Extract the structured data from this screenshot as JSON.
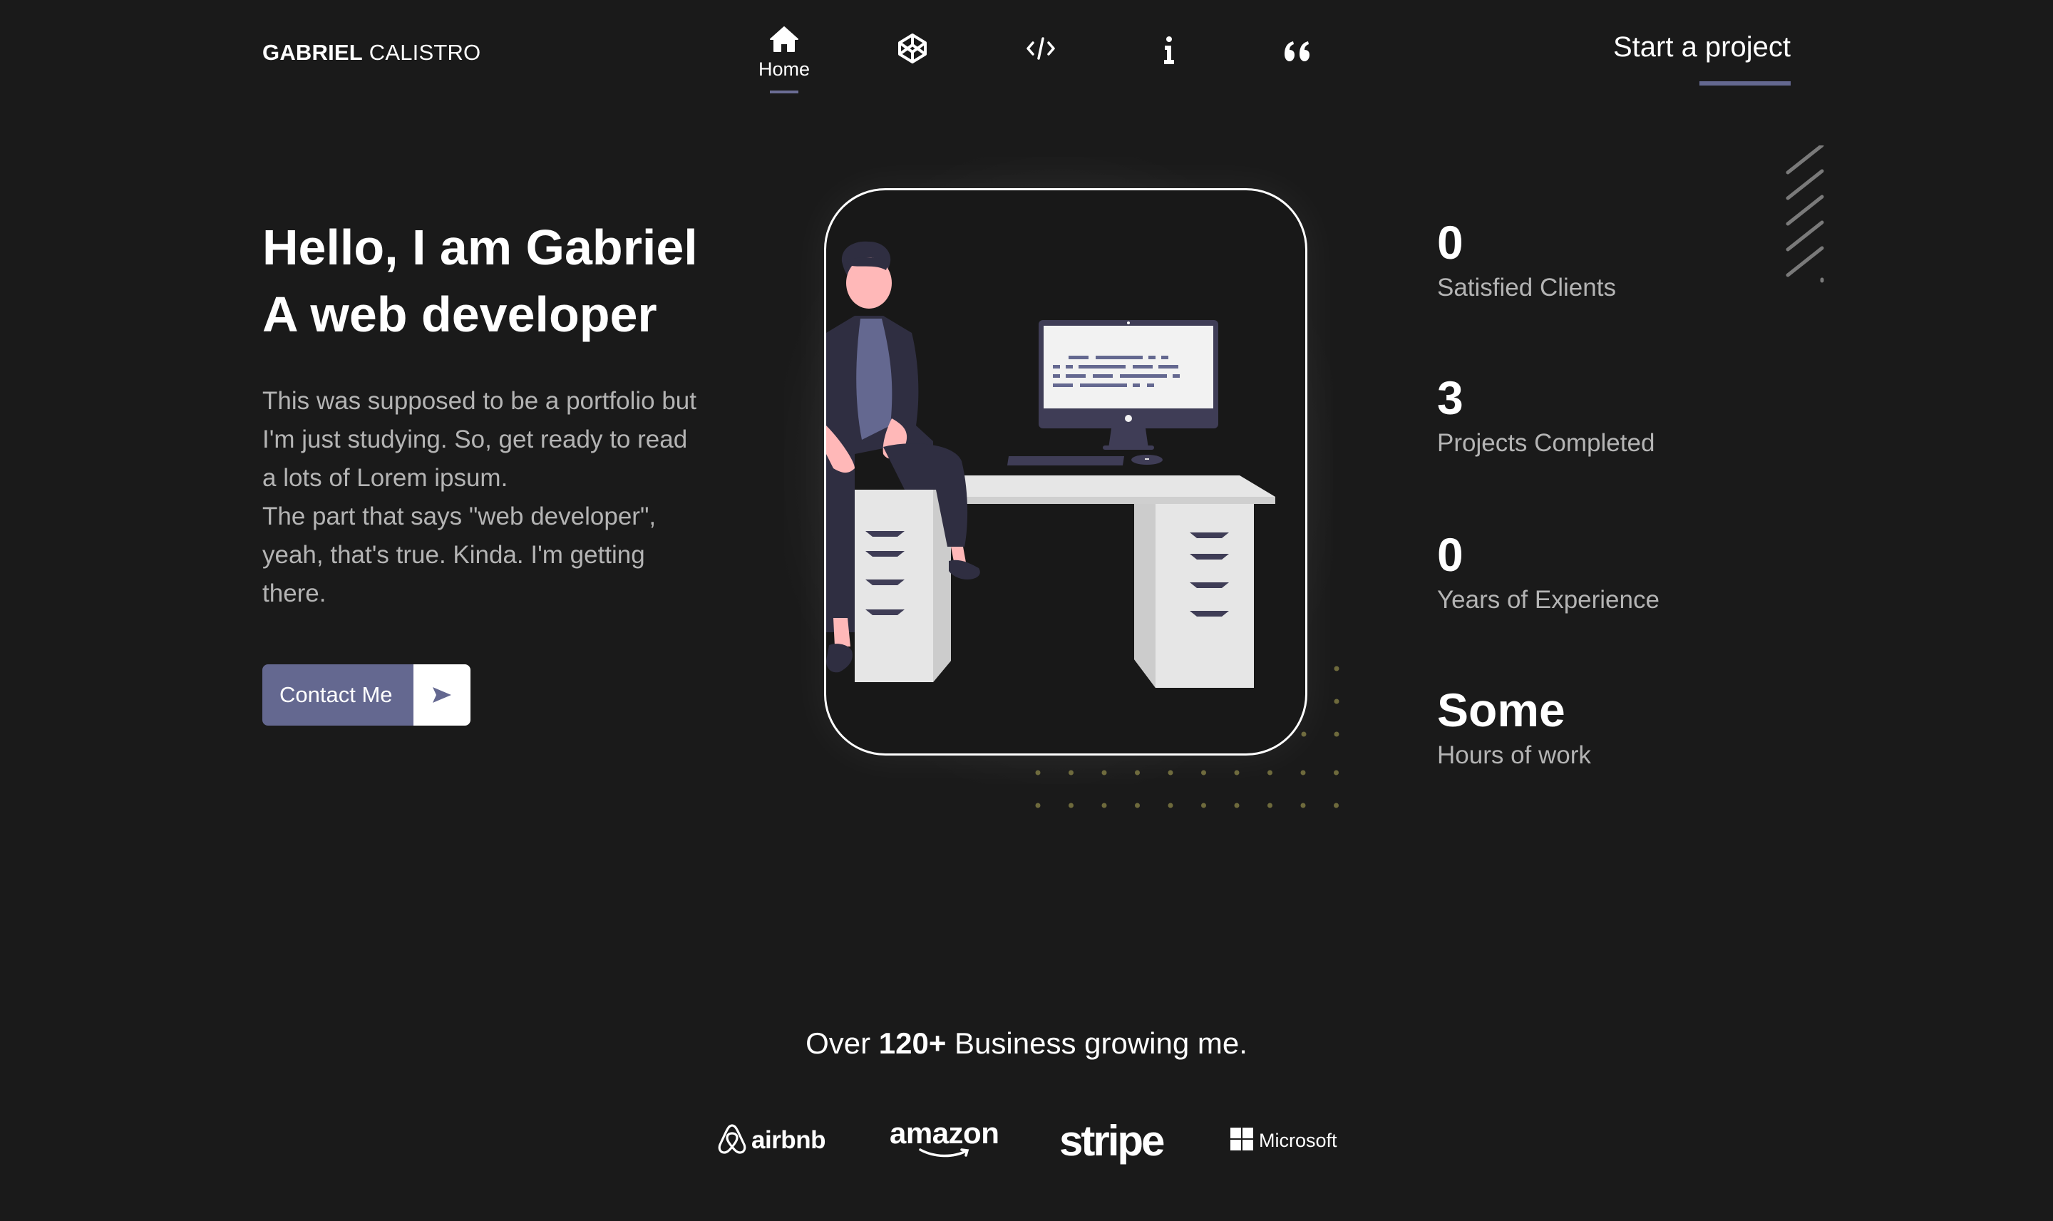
{
  "header": {
    "logo_first": "GABRIEL",
    "logo_last": "CALISTRO",
    "nav": [
      {
        "id": "home",
        "icon": "home-icon",
        "label": "Home",
        "active": true
      },
      {
        "id": "projects",
        "icon": "codepen-icon",
        "label": "",
        "active": false
      },
      {
        "id": "code",
        "icon": "code-icon",
        "label": "",
        "active": false
      },
      {
        "id": "about",
        "icon": "info-icon",
        "label": "",
        "active": false
      },
      {
        "id": "testimonials",
        "icon": "quote-icon",
        "label": "",
        "active": false
      }
    ],
    "cta_label": "Start a project"
  },
  "hero": {
    "title_line1": "Hello, I am Gabriel",
    "title_line2": "A web developer",
    "body_para1": "This was supposed to be a portfolio but I'm just studying. So, get ready to read a lots of Lorem ipsum.",
    "body_para2": "The part that says \"web developer\", yeah, that's true. Kinda. I'm getting there.",
    "contact_label": "Contact Me",
    "contact_icon": "send-icon"
  },
  "illustration": {
    "subject": "person-sitting-at-desk-with-computer"
  },
  "stats": [
    {
      "value": "0",
      "caption": "Satisfied Clients"
    },
    {
      "value": "3",
      "caption": "Projects Completed"
    },
    {
      "value": "0",
      "caption": "Years of Experience"
    },
    {
      "value": "Some",
      "caption": "Hours of work"
    }
  ],
  "partners": {
    "prefix": "Over",
    "count": "120+",
    "suffix": "Business growing me.",
    "brands": [
      "airbnb",
      "amazon",
      "stripe",
      "Microsoft"
    ]
  },
  "colors": {
    "background": "#1a1a1a",
    "accent": "#646890",
    "muted_text": "#b4b4b4",
    "dots": "#6e6a3c"
  }
}
